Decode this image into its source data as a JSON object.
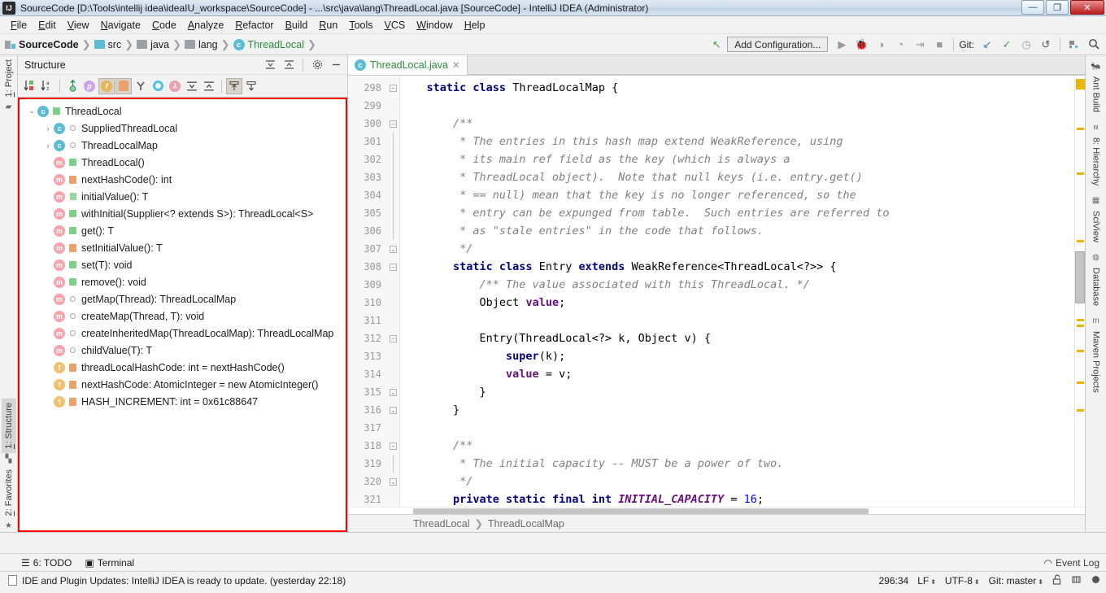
{
  "window": {
    "title": "SourceCode [D:\\Tools\\intellij idea\\ideaIU_workspace\\SourceCode] - ...\\src\\java\\lang\\ThreadLocal.java [SourceCode] - IntelliJ IDEA (Administrator)",
    "app_badge": "IJ",
    "minimize": "—",
    "maximize": "❐",
    "close": "✕"
  },
  "menubar": {
    "items": [
      "File",
      "Edit",
      "View",
      "Navigate",
      "Code",
      "Analyze",
      "Refactor",
      "Build",
      "Run",
      "Tools",
      "VCS",
      "Window",
      "Help"
    ]
  },
  "navbar": {
    "breadcrumbs": [
      {
        "label": "SourceCode",
        "icon": "module-icon",
        "style": "bold"
      },
      {
        "label": "src",
        "icon": "source-folder-icon",
        "style": "normal"
      },
      {
        "label": "java",
        "icon": "folder-icon",
        "style": "normal"
      },
      {
        "label": "lang",
        "icon": "folder-icon",
        "style": "normal"
      },
      {
        "label": "ThreadLocal",
        "icon": "class-icon",
        "style": "green"
      }
    ],
    "separator": "❯",
    "run_config_label": "Add Configuration...",
    "git_label": "Git:",
    "icons": {
      "back_arrow": "↖",
      "run": "▶",
      "debug": "🐞",
      "run_coverage": "◑",
      "profile": "◔",
      "run_tests": "⇥",
      "stop": "■",
      "update_project": "↙",
      "commit": "✓",
      "history": "◷",
      "rollback": "↺",
      "settings": "⚙",
      "search": "🔍"
    }
  },
  "left_rail": {
    "top_tabs": [
      {
        "label": "1: Project",
        "selected": false
      }
    ],
    "bottom_tabs": [
      {
        "label": "1: Structure",
        "selected": true
      },
      {
        "label": "2: Favorites",
        "selected": false
      }
    ]
  },
  "right_rail": {
    "tabs": [
      {
        "label": "Ant Build",
        "icon": "ant-icon"
      },
      {
        "label": "8: Hierarchy",
        "icon": "hierarchy-icon"
      },
      {
        "label": "SciView",
        "icon": "sciview-icon"
      },
      {
        "label": "Database",
        "icon": "database-icon"
      },
      {
        "label": "Maven Projects",
        "icon": "maven-icon"
      }
    ]
  },
  "structure": {
    "title": "Structure",
    "header_icons": [
      "expand-all-icon",
      "collapse-all-icon",
      "gear-icon",
      "hide-icon"
    ],
    "toolbar": [
      {
        "name": "sort-by-visibility-icon",
        "glyph": "↓",
        "active": false
      },
      {
        "name": "sort-alphabetically-icon",
        "glyph": "↓",
        "active": false
      },
      {
        "name": "show-inherited-icon",
        "glyph": "↑",
        "active": false
      },
      {
        "name": "show-properties-icon",
        "glyph": "p",
        "active": false
      },
      {
        "name": "show-fields-icon",
        "glyph": "f",
        "active": true
      },
      {
        "name": "show-non-public-icon",
        "glyph": "🔒",
        "active": true
      },
      {
        "name": "show-anonymous-icon",
        "glyph": "Y",
        "active": false
      },
      {
        "name": "show-classes-icon",
        "glyph": "O",
        "active": false
      },
      {
        "name": "show-lambdas-icon",
        "glyph": "λ",
        "active": false
      },
      {
        "name": "expand-all-icon",
        "glyph": "⇳",
        "active": false
      },
      {
        "name": "collapse-all-icon",
        "glyph": "⇡",
        "active": false
      },
      {
        "name": "autoscroll-to-source-icon",
        "glyph": "⇧",
        "active": true
      },
      {
        "name": "autoscroll-from-source-icon",
        "glyph": "⇩",
        "active": false
      }
    ],
    "tree": [
      {
        "label": "ThreadLocal",
        "indent": 0,
        "arrow": "expanded",
        "badge": "c",
        "vis": "public",
        "static": false
      },
      {
        "label": "SuppliedThreadLocal",
        "indent": 1,
        "arrow": "collapsed",
        "badge": "c",
        "vis": "package",
        "static": true
      },
      {
        "label": "ThreadLocalMap",
        "indent": 1,
        "arrow": "collapsed",
        "badge": "c",
        "vis": "package",
        "static": true
      },
      {
        "label": "ThreadLocal()",
        "indent": 1,
        "arrow": "none",
        "badge": "m",
        "vis": "public",
        "static": false
      },
      {
        "label": "nextHashCode(): int",
        "indent": 1,
        "arrow": "none",
        "badge": "m",
        "vis": "protected",
        "static": true
      },
      {
        "label": "initialValue(): T",
        "indent": 1,
        "arrow": "none",
        "badge": "m",
        "vis": "private",
        "static": false
      },
      {
        "label": "withInitial(Supplier<? extends S>): ThreadLocal<S>",
        "indent": 1,
        "arrow": "none",
        "badge": "m",
        "vis": "public",
        "static": true
      },
      {
        "label": "get(): T",
        "indent": 1,
        "arrow": "none",
        "badge": "m",
        "vis": "public",
        "static": false
      },
      {
        "label": "setInitialValue(): T",
        "indent": 1,
        "arrow": "none",
        "badge": "m",
        "vis": "protected",
        "static": false
      },
      {
        "label": "set(T): void",
        "indent": 1,
        "arrow": "none",
        "badge": "m",
        "vis": "public",
        "static": false
      },
      {
        "label": "remove(): void",
        "indent": 1,
        "arrow": "none",
        "badge": "m",
        "vis": "public",
        "static": false
      },
      {
        "label": "getMap(Thread): ThreadLocalMap",
        "indent": 1,
        "arrow": "none",
        "badge": "m",
        "vis": "package",
        "static": false
      },
      {
        "label": "createMap(Thread, T): void",
        "indent": 1,
        "arrow": "none",
        "badge": "m",
        "vis": "package",
        "static": false
      },
      {
        "label": "createInheritedMap(ThreadLocalMap): ThreadLocalMap",
        "indent": 1,
        "arrow": "none",
        "badge": "m",
        "vis": "package",
        "static": true
      },
      {
        "label": "childValue(T): T",
        "indent": 1,
        "arrow": "none",
        "badge": "m",
        "vis": "package",
        "static": false
      },
      {
        "label": "threadLocalHashCode: int = nextHashCode()",
        "indent": 1,
        "arrow": "none",
        "badge": "f",
        "vis": "protected",
        "static": false
      },
      {
        "label": "nextHashCode: AtomicInteger = new AtomicInteger()",
        "indent": 1,
        "arrow": "none",
        "badge": "f",
        "vis": "protected",
        "static": true
      },
      {
        "label": "HASH_INCREMENT: int = 0x61c88647",
        "indent": 1,
        "arrow": "none",
        "badge": "f",
        "vis": "protected",
        "static": true
      }
    ],
    "highlight_color": "#ff0000"
  },
  "editor": {
    "tab": {
      "label": "ThreadLocal.java",
      "icon": "java-class-icon",
      "close": "✕"
    },
    "first_line_number": 298,
    "lines": [
      {
        "n": 298,
        "fold": "minus",
        "tokens": [
          {
            "t": "    ",
            "c": ""
          },
          {
            "t": "static class ",
            "c": "kw"
          },
          {
            "t": "ThreadLocalMap {",
            "c": ""
          }
        ]
      },
      {
        "n": 299,
        "fold": "",
        "tokens": []
      },
      {
        "n": 300,
        "fold": "minus",
        "tokens": [
          {
            "t": "        /**",
            "c": "cm"
          }
        ]
      },
      {
        "n": 301,
        "fold": "bar",
        "tokens": [
          {
            "t": "         * The entries in this hash map extend WeakReference, using",
            "c": "cm"
          }
        ]
      },
      {
        "n": 302,
        "fold": "bar",
        "tokens": [
          {
            "t": "         * its main ref field as the key (which is always a",
            "c": "cm"
          }
        ]
      },
      {
        "n": 303,
        "fold": "bar",
        "tokens": [
          {
            "t": "         * ThreadLocal object).  Note that null keys (i.e. entry.get()",
            "c": "cm"
          }
        ]
      },
      {
        "n": 304,
        "fold": "bar",
        "tokens": [
          {
            "t": "         * == null) mean that the key is no longer referenced, so the",
            "c": "cm"
          }
        ]
      },
      {
        "n": 305,
        "fold": "bar",
        "tokens": [
          {
            "t": "         * entry can be expunged from table.  Such entries are referred to",
            "c": "cm"
          }
        ]
      },
      {
        "n": 306,
        "fold": "bar",
        "tokens": [
          {
            "t": "         * as \"stale entries\" in the code that follows.",
            "c": "cm"
          }
        ]
      },
      {
        "n": 307,
        "fold": "plus",
        "tokens": [
          {
            "t": "         */",
            "c": "cm"
          }
        ]
      },
      {
        "n": 308,
        "fold": "minus",
        "tokens": [
          {
            "t": "        ",
            "c": ""
          },
          {
            "t": "static class ",
            "c": "kw"
          },
          {
            "t": "Entry ",
            "c": ""
          },
          {
            "t": "extends ",
            "c": "kw"
          },
          {
            "t": "WeakReference<ThreadLocal<?>> {",
            "c": ""
          }
        ]
      },
      {
        "n": 309,
        "fold": "",
        "tokens": [
          {
            "t": "            /** The value associated with this ThreadLocal. */",
            "c": "cm"
          }
        ]
      },
      {
        "n": 310,
        "fold": "",
        "tokens": [
          {
            "t": "            Object ",
            "c": ""
          },
          {
            "t": "value",
            "c": "fld"
          },
          {
            "t": ";",
            "c": ""
          }
        ]
      },
      {
        "n": 311,
        "fold": "",
        "tokens": []
      },
      {
        "n": 312,
        "fold": "minus",
        "tokens": [
          {
            "t": "            Entry(ThreadLocal<?> k, Object v) {",
            "c": ""
          }
        ]
      },
      {
        "n": 313,
        "fold": "",
        "tokens": [
          {
            "t": "                ",
            "c": ""
          },
          {
            "t": "super",
            "c": "kw"
          },
          {
            "t": "(k);",
            "c": ""
          }
        ]
      },
      {
        "n": 314,
        "fold": "",
        "tokens": [
          {
            "t": "                ",
            "c": ""
          },
          {
            "t": "value ",
            "c": "fld"
          },
          {
            "t": "= v;",
            "c": ""
          }
        ]
      },
      {
        "n": 315,
        "fold": "plus",
        "tokens": [
          {
            "t": "            }",
            "c": ""
          }
        ]
      },
      {
        "n": 316,
        "fold": "plus",
        "tokens": [
          {
            "t": "        }",
            "c": ""
          }
        ]
      },
      {
        "n": 317,
        "fold": "",
        "tokens": []
      },
      {
        "n": 318,
        "fold": "minus",
        "tokens": [
          {
            "t": "        /**",
            "c": "cm"
          }
        ]
      },
      {
        "n": 319,
        "fold": "bar",
        "tokens": [
          {
            "t": "         * The initial capacity -- MUST be a power of two.",
            "c": "cm"
          }
        ]
      },
      {
        "n": 320,
        "fold": "plus",
        "tokens": [
          {
            "t": "         */",
            "c": "cm"
          }
        ]
      },
      {
        "n": 321,
        "fold": "",
        "tokens": [
          {
            "t": "        ",
            "c": ""
          },
          {
            "t": "private static final int ",
            "c": "kw"
          },
          {
            "t": "INITIAL_CAPACITY ",
            "c": "cst"
          },
          {
            "t": "= ",
            "c": ""
          },
          {
            "t": "16",
            "c": "num"
          },
          {
            "t": ";",
            "c": ""
          }
        ]
      },
      {
        "n": 322,
        "fold": "",
        "tokens": []
      }
    ],
    "breadcrumb": [
      "ThreadLocal",
      "ThreadLocalMap"
    ],
    "breadcrumb_sep": "❯",
    "marker_color": "#e8b800"
  },
  "toolwindow_bar": {
    "items": [
      {
        "label": "6: TODO",
        "underline": "6",
        "icon": "todo-icon"
      },
      {
        "label": "Terminal",
        "icon": "terminal-icon"
      }
    ],
    "event_log": {
      "label": "Event Log",
      "icon": "event-log-icon"
    }
  },
  "statusbar": {
    "message": "IDE and Plugin Updates: IntelliJ IDEA is ready to update. (yesterday 22:18)",
    "caret_position": "296:34",
    "line_separator": "LF",
    "encoding": "UTF-8",
    "branch": "Git: master",
    "lock_icon": "read-write-icon",
    "memory_icon": "memory-indicator-icon",
    "inspection_icon": "inspection-icon"
  }
}
